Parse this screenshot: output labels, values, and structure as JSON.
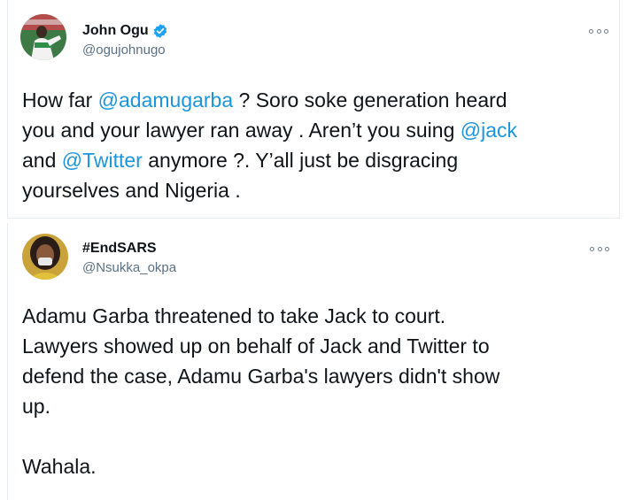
{
  "tweets": [
    {
      "display_name": "John Ogu",
      "handle": "@ogujohnugo",
      "verified": true,
      "more_icon": "more-options-icon",
      "lines": [
        [
          {
            "t": "How far ",
            "m": false
          },
          {
            "t": "@adamugarba",
            "m": true
          },
          {
            "t": " ? Soro soke generation heard",
            "m": false
          }
        ],
        [
          {
            "t": "you and your lawyer ran away . Aren’t you suing ",
            "m": false
          },
          {
            "t": "@jack",
            "m": true
          }
        ],
        [
          {
            "t": "and ",
            "m": false
          },
          {
            "t": "@Twitter",
            "m": true
          },
          {
            "t": " anymore ?. Y’all just be disgracing",
            "m": false
          }
        ],
        [
          {
            "t": "yourselves and Nigeria .",
            "m": false
          }
        ]
      ]
    },
    {
      "display_name": "#EndSARS",
      "handle": "@Nsukka_okpa",
      "verified": false,
      "more_icon": "more-options-icon",
      "lines": [
        [
          {
            "t": "Adamu Garba threatened to take Jack to court.",
            "m": false
          }
        ],
        [
          {
            "t": "Lawyers showed up on behalf of Jack and Twitter to",
            "m": false
          }
        ],
        [
          {
            "t": "defend the case, Adamu Garba's lawyers didn't show",
            "m": false
          }
        ],
        [
          {
            "t": "up.",
            "m": false
          }
        ],
        [],
        [
          {
            "t": "Wahala.",
            "m": false
          }
        ]
      ]
    }
  ],
  "colors": {
    "mention": "#1b95e0",
    "handle": "#5b7083",
    "verified": "#1da1f2",
    "text": "#0f1419"
  }
}
